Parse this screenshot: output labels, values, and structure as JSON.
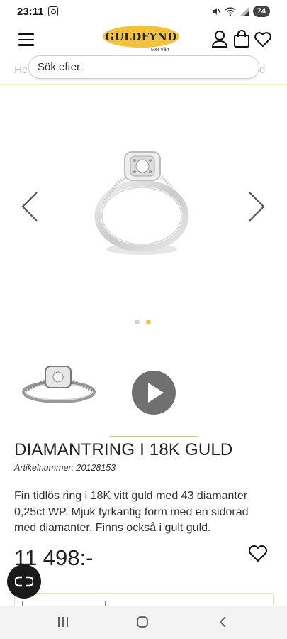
{
  "status_bar": {
    "time": "23:11",
    "battery": "74"
  },
  "header": {
    "logo_text": "GULDFYND",
    "logo_tagline": "Mer vårt"
  },
  "search": {
    "placeholder": "Sök efter.."
  },
  "breadcrumb": {
    "left_fragment": "He",
    "right_fragment": "d"
  },
  "gallery": {
    "slide_count": 2,
    "active_slide": 2
  },
  "product": {
    "title": "DIAMANTRING I 18K GULD",
    "article_number": "Artikelnummer: 20128153",
    "description": "Fin tidlös ring i 18K vitt guld med 43 diamanter 0,25ct WP. Mjuk fyrkantig form med en sidorad med diamanter. Finns också i gult guld.",
    "price": "11 498:-"
  },
  "colors": {
    "brand_gold": "#f3c23a",
    "accent_dot": "#e8c350",
    "chat_button": "#1a1a1a"
  },
  "icons": [
    "menu-icon",
    "account-icon",
    "cart-icon",
    "heart-icon",
    "chevron-left-icon",
    "chevron-right-icon",
    "play-icon",
    "chat-icon",
    "nav-recents-icon",
    "nav-home-icon",
    "nav-back-icon"
  ]
}
